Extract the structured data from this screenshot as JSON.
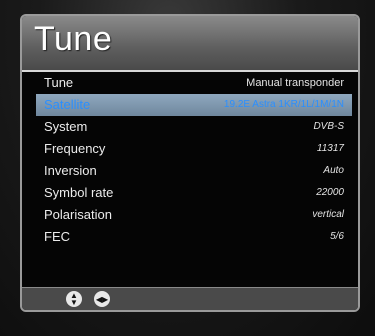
{
  "title": "Tune",
  "rows": [
    {
      "label": "Tune",
      "value": "Manual transponder"
    },
    {
      "label": "Satellite",
      "value": "19.2E Astra 1KR/1L/1M/1N"
    },
    {
      "label": "System",
      "value": "DVB-S"
    },
    {
      "label": "Frequency",
      "value": "11317"
    },
    {
      "label": "Inversion",
      "value": "Auto"
    },
    {
      "label": "Symbol rate",
      "value": "22000"
    },
    {
      "label": "Polarisation",
      "value": "vertical"
    },
    {
      "label": "FEC",
      "value": "5/6"
    }
  ],
  "colors": {
    "selected_bar": "#7f98ae",
    "selected_text": "#2a8fff",
    "panel_background": "#050505"
  },
  "icons": {
    "up_down": "up-down-arrows-icon",
    "left_right": "left-right-arrows-icon"
  }
}
